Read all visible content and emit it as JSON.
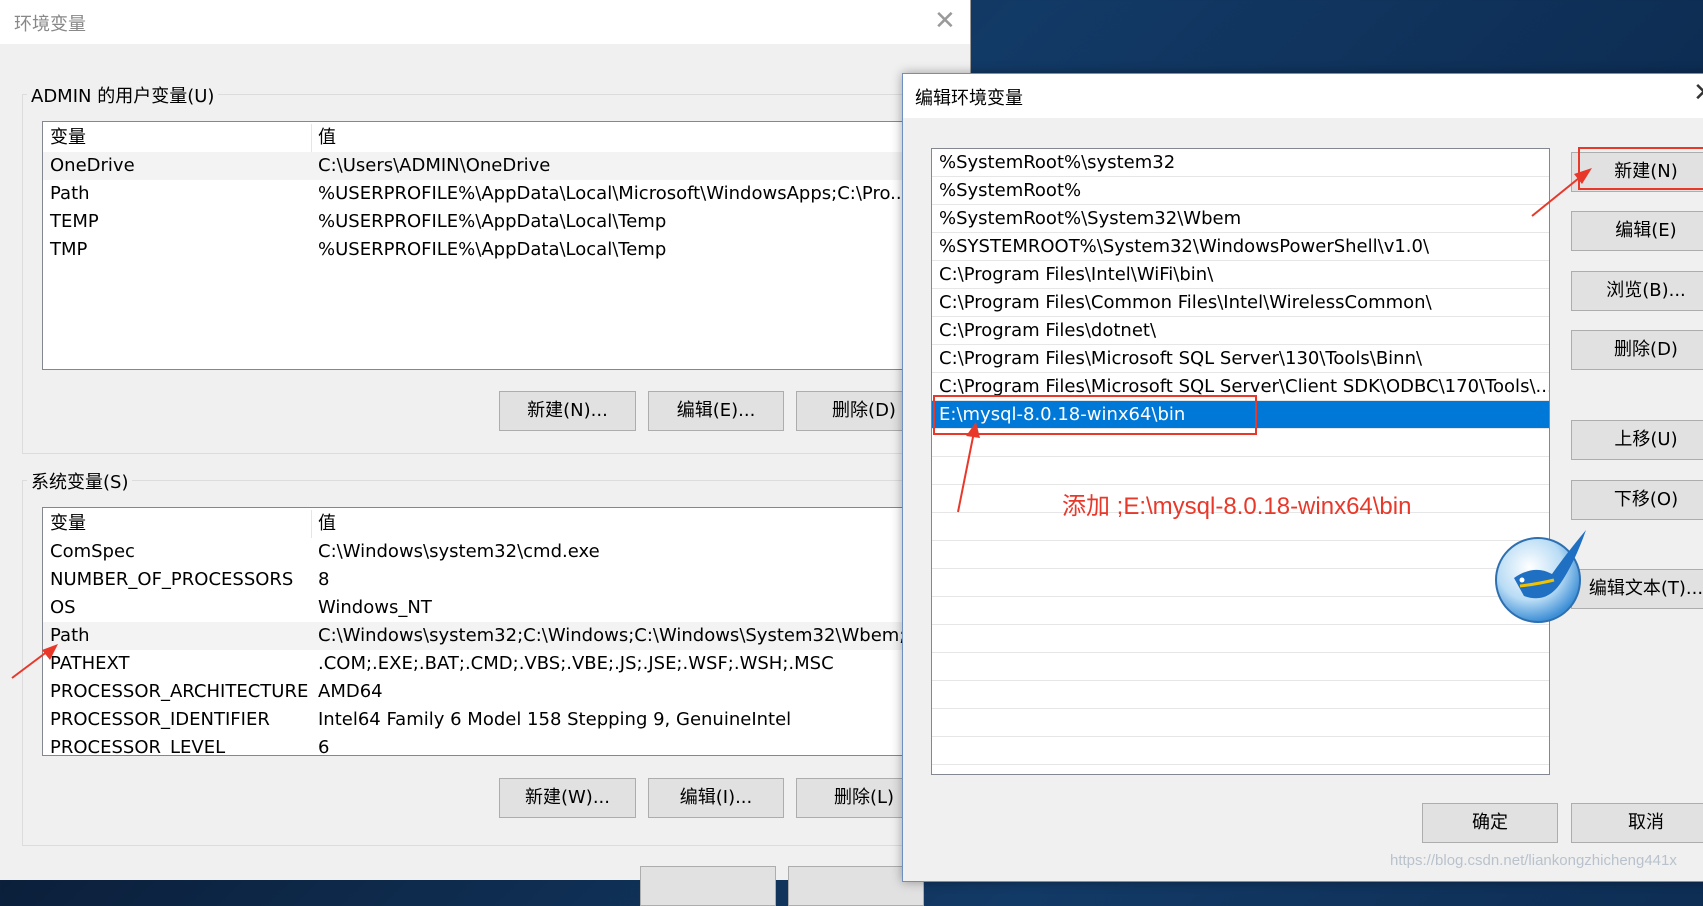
{
  "env_window": {
    "title": "环境变量",
    "close_glyph": "✕",
    "user_group_label": "ADMIN 的用户变量(U)",
    "user_header": {
      "name": "变量",
      "value": "值"
    },
    "user_rows": [
      {
        "name": "OneDrive",
        "value": "C:\\Users\\ADMIN\\OneDrive"
      },
      {
        "name": "Path",
        "value": "%USERPROFILE%\\AppData\\Local\\Microsoft\\WindowsApps;C:\\Pro..."
      },
      {
        "name": "TEMP",
        "value": "%USERPROFILE%\\AppData\\Local\\Temp"
      },
      {
        "name": "TMP",
        "value": "%USERPROFILE%\\AppData\\Local\\Temp"
      }
    ],
    "user_buttons": {
      "new": "新建(N)...",
      "edit": "编辑(E)...",
      "delete": "删除(D)"
    },
    "system_group_label": "系统变量(S)",
    "system_header": {
      "name": "变量",
      "value": "值"
    },
    "system_rows": [
      {
        "name": "ComSpec",
        "value": "C:\\Windows\\system32\\cmd.exe"
      },
      {
        "name": "NUMBER_OF_PROCESSORS",
        "value": "8"
      },
      {
        "name": "OS",
        "value": "Windows_NT"
      },
      {
        "name": "Path",
        "value": "C:\\Windows\\system32;C:\\Windows;C:\\Windows\\System32\\Wbem;..."
      },
      {
        "name": "PATHEXT",
        "value": ".COM;.EXE;.BAT;.CMD;.VBS;.VBE;.JS;.JSE;.WSF;.WSH;.MSC"
      },
      {
        "name": "PROCESSOR_ARCHITECTURE",
        "value": "AMD64"
      },
      {
        "name": "PROCESSOR_IDENTIFIER",
        "value": "Intel64 Family 6 Model 158 Stepping 9, GenuineIntel"
      },
      {
        "name": "PROCESSOR_LEVEL",
        "value": "6"
      }
    ],
    "system_buttons": {
      "new": "新建(W)...",
      "edit": "编辑(I)...",
      "delete": "删除(L)"
    }
  },
  "edit_dialog": {
    "title": "编辑环境变量",
    "close_glyph": "✕",
    "paths": [
      "%SystemRoot%\\system32",
      "%SystemRoot%",
      "%SystemRoot%\\System32\\Wbem",
      "%SYSTEMROOT%\\System32\\WindowsPowerShell\\v1.0\\",
      "C:\\Program Files\\Intel\\WiFi\\bin\\",
      "C:\\Program Files\\Common Files\\Intel\\WirelessCommon\\",
      "C:\\Program Files\\dotnet\\",
      "C:\\Program Files\\Microsoft SQL Server\\130\\Tools\\Binn\\",
      "C:\\Program Files\\Microsoft SQL Server\\Client SDK\\ODBC\\170\\Tools\\...",
      "E:\\mysql-8.0.18-winx64\\bin"
    ],
    "buttons": {
      "new": "新建(N)",
      "edit": "编辑(E)",
      "browse": "浏览(B)...",
      "delete": "删除(D)",
      "move_up": "上移(U)",
      "move_down": "下移(O)",
      "edit_text": "编辑文本(T)...",
      "ok": "确定",
      "cancel": "取消"
    }
  },
  "annotation": {
    "text": "添加 ;E:\\mysql-8.0.18-winx64\\bin",
    "color": "#e8382a"
  },
  "watermark": "https://blog.csdn.net/liankongzhicheng441x",
  "selection_color": "#0078d7"
}
